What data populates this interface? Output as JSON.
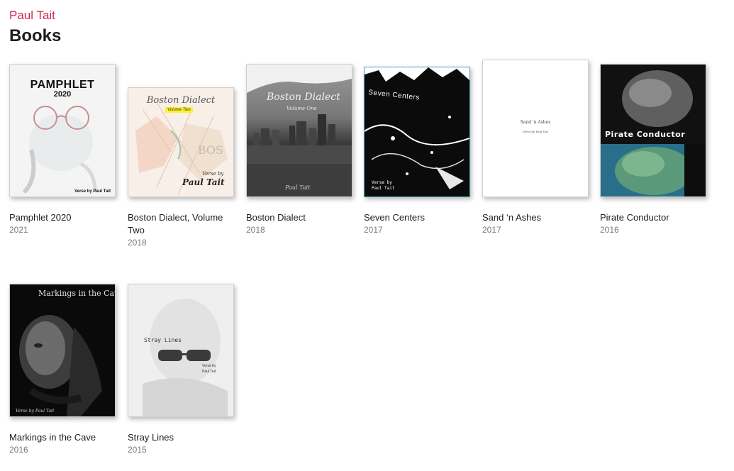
{
  "header": {
    "author": "Paul Tait",
    "section_title": "Books"
  },
  "books": [
    {
      "title": "Pamphlet 2020",
      "year": "2021",
      "cover": {
        "title_line1": "PAMPHLET",
        "title_line2": "2020",
        "byline": "Verse by Paul Tait"
      }
    },
    {
      "title": "Boston Dialect, Volume Two",
      "year": "2018",
      "cover": {
        "title": "Boston Dialect",
        "subtitle": "Volume Two",
        "byline_top": "Verse by",
        "byline_name": "Paul Tait",
        "map_word": "BOS"
      }
    },
    {
      "title": "Boston Dialect",
      "year": "2018",
      "cover": {
        "title": "Boston Dialect",
        "subtitle": "Volume One",
        "byline": "Paul Tait"
      }
    },
    {
      "title": "Seven Centers",
      "year": "2017",
      "cover": {
        "title": "Seven Centers",
        "byline_top": "Verse by",
        "byline_name": "Paul Tait"
      }
    },
    {
      "title": "Sand ‘n Ashes",
      "year": "2017",
      "cover": {
        "title": "Sand 'n Ashes",
        "byline": "Verse by Paul Tait"
      }
    },
    {
      "title": "Pirate Conductor",
      "year": "2016",
      "cover": {
        "title": "Pirate Conductor"
      }
    },
    {
      "title": "Markings in the Cave",
      "year": "2016",
      "cover": {
        "title": "Markings in the Cave",
        "byline": "Verse by Paul Tait"
      }
    },
    {
      "title": "Stray Lines",
      "year": "2015",
      "cover": {
        "title": "Stray Lines",
        "byline_top": "Verse by",
        "byline_name": "Paul Tait"
      }
    }
  ]
}
